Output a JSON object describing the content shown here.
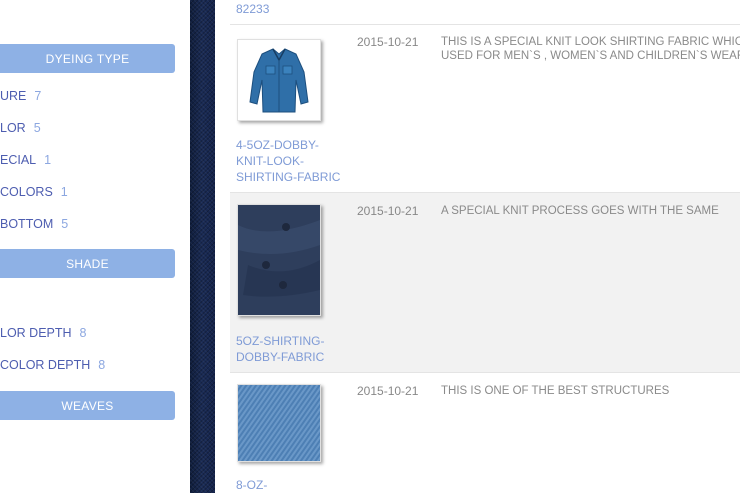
{
  "sidebar": {
    "dyeing_header": "DYEING TYPE",
    "dyeing_items": [
      {
        "label": "URE",
        "count": "7"
      },
      {
        "label": "LOR",
        "count": "5"
      },
      {
        "label": "ECIAL",
        "count": "1"
      },
      {
        "label": "COLORS",
        "count": "1"
      },
      {
        "label": "BOTTOM",
        "count": "5"
      }
    ],
    "shade_header": "SHADE",
    "shade_items": [
      {
        "label": "LOR DEPTH",
        "count": "8"
      },
      {
        "label": "COLOR DEPTH",
        "count": "8"
      }
    ],
    "weaves_header": "WEAVES"
  },
  "main": {
    "prev_code": "82233",
    "rows": [
      {
        "link": "4-5OZ-DOBBY-KNIT-LOOK-SHIRTING-FABRIC",
        "date": "2015-10-21",
        "description": "THIS IS A SPECIAL KNIT LOOK SHIRTING FABRIC WHICH USED FOR MEN`S , WOMEN`S AND CHILDREN`S WEAR"
      },
      {
        "link": "5OZ-SHIRTING-DOBBY-FABRIC",
        "date": "2015-10-21",
        "description": "A SPECIAL KNIT PROCESS GOES WITH THE SAME"
      },
      {
        "link": "8-OZ-",
        "date": "2015-10-21",
        "description": "THIS IS ONE OF THE BEST STRUCTURES"
      }
    ]
  },
  "colors": {
    "header_bg": "#8eb1e5",
    "link": "#7f9bd6",
    "denim": "#1a2b55"
  }
}
